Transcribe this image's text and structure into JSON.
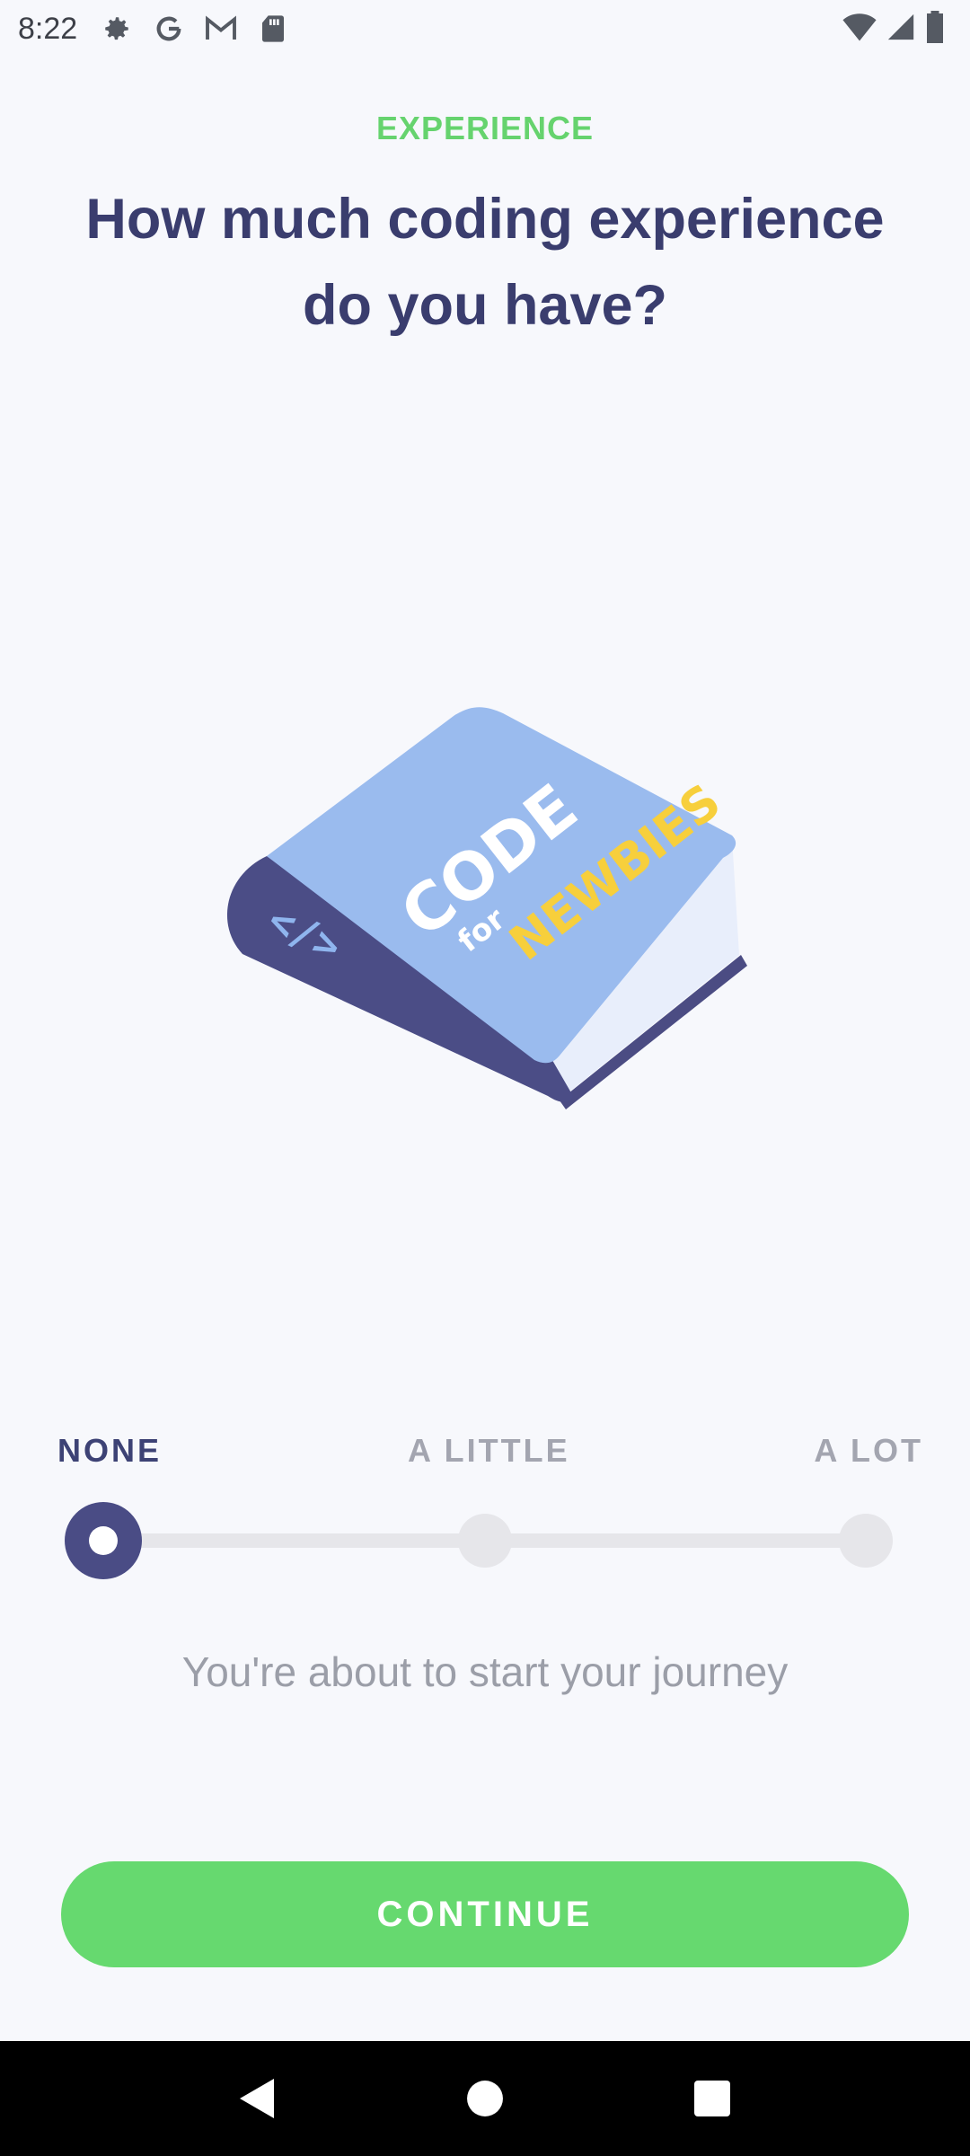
{
  "status_bar": {
    "time": "8:22",
    "left_icons": [
      "settings-icon",
      "google-icon",
      "gmail-icon",
      "sd-card-icon"
    ],
    "right_icons": [
      "wifi-icon",
      "cell-signal-icon",
      "battery-icon"
    ]
  },
  "header": {
    "overline": "EXPERIENCE",
    "title": "How much coding experience do you have?"
  },
  "illustration": {
    "cover_line1": "CODE",
    "cover_line2": "for",
    "cover_line3": "NEWBIES",
    "spine_symbol": "</>"
  },
  "slider": {
    "labels": [
      "NONE",
      "A LITTLE",
      "A LOT"
    ],
    "selected": "NONE",
    "caption": "You're about to start your journey"
  },
  "actions": {
    "continue_label": "CONTINUE"
  },
  "colors": {
    "accent_green": "#66d96f",
    "title_navy": "#3a3d6e",
    "thumb_navy": "#4a4c85"
  }
}
